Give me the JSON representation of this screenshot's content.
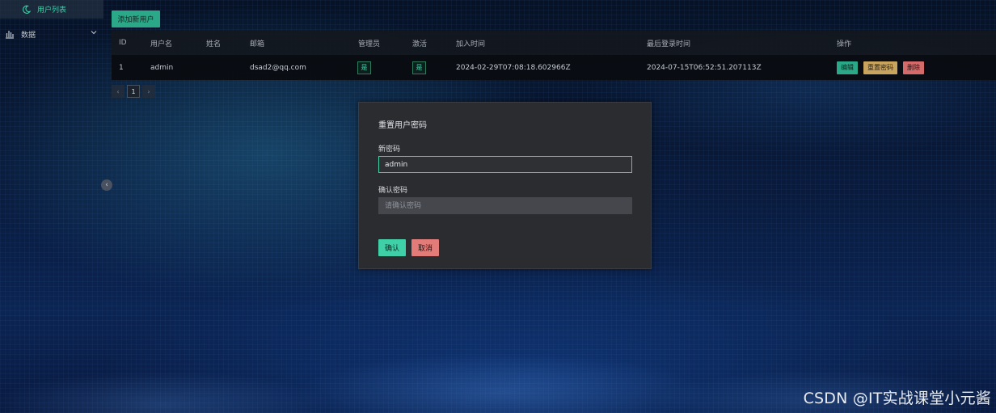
{
  "sidebar": {
    "items": [
      {
        "label": "用户列表",
        "icon": "moon-icon",
        "active": true
      },
      {
        "label": "数据",
        "icon": "bar-chart-icon",
        "active": false
      }
    ]
  },
  "toolbar": {
    "add_label": "添加新用户"
  },
  "table": {
    "headers": {
      "id": "ID",
      "username": "用户名",
      "name": "姓名",
      "email": "邮箱",
      "admin": "管理员",
      "active": "激活",
      "joined": "加入时间",
      "last_login": "最后登录时间",
      "actions": "操作"
    },
    "rows": [
      {
        "id": "1",
        "username": "admin",
        "name": "",
        "email": "dsad2@qq.com",
        "admin": "是",
        "active": "是",
        "joined": "2024-02-29T07:08:18.602966Z",
        "last_login": "2024-07-15T06:52:51.207113Z",
        "actions": {
          "edit": "编辑",
          "reset": "重置密码",
          "delete": "删除"
        }
      }
    ]
  },
  "pagination": {
    "prev": "‹",
    "current": "1",
    "next": "›"
  },
  "modal": {
    "title": "重置用户密码",
    "new_password_label": "新密码",
    "new_password_value": "admin",
    "confirm_password_label": "确认密码",
    "confirm_password_placeholder": "请确认密码",
    "ok_label": "确认",
    "cancel_label": "取消"
  },
  "collapse_icon": "‹",
  "watermark": "CSDN @IT实战课堂小元酱",
  "colors": {
    "accent": "#3fd0a8",
    "warning": "#c9a45e",
    "danger": "#d46a6a"
  }
}
